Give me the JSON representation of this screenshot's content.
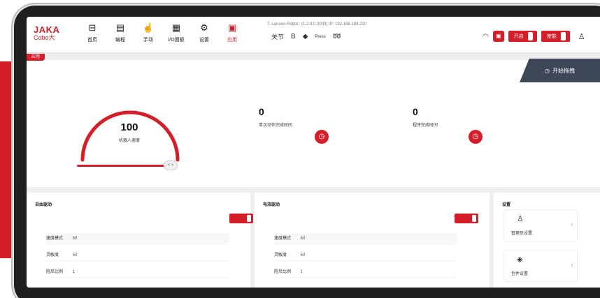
{
  "app": {
    "logo_main": "JAKA",
    "logo_sub": "Cobo大",
    "connection": "T: Lenovo-Robot.. (1.2.0.0.0000)    IP: 192.168.184.210"
  },
  "nav": [
    {
      "label": "首页",
      "icon": "monitor-icon",
      "active": false
    },
    {
      "label": "编程",
      "icon": "program-icon",
      "active": false
    },
    {
      "label": "手动",
      "icon": "hand-icon",
      "active": false
    },
    {
      "label": "I/O面板",
      "icon": "io-icon",
      "active": false
    },
    {
      "label": "设置",
      "icon": "gear-icon",
      "active": false
    },
    {
      "label": "应用",
      "icon": "app-icon",
      "active": true
    }
  ],
  "toolbar": {
    "mode_label": "关节",
    "items": [
      "B",
      "◆",
      "⊟",
      "➿"
    ],
    "small_label": "Press"
  },
  "right_buttons": {
    "power_label": "开启",
    "enable_label": "使能"
  },
  "panel_tag": "应用",
  "start_button": "开始拖拽",
  "gauge": {
    "value": "100",
    "label": "机器人速度",
    "fraction": 1.0,
    "slider_handle": "< >"
  },
  "stats": [
    {
      "value": "0",
      "label": "单次动作完成时间",
      "icon": "timer-icon"
    },
    {
      "value": "0",
      "label": "程序完成时间",
      "icon": "timer-icon"
    }
  ],
  "cards": [
    {
      "title": "自由驱动",
      "fields": [
        {
          "label": "速度模式",
          "value": "60"
        },
        {
          "label": "灵敏度",
          "value": "50"
        },
        {
          "label": "阻尼比例",
          "value": "1"
        }
      ]
    },
    {
      "title": "电流驱动",
      "fields": [
        {
          "label": "速度模式",
          "value": "60"
        },
        {
          "label": "灵敏度",
          "value": "50"
        },
        {
          "label": "阻尼比例",
          "value": "1"
        }
      ]
    }
  ],
  "settings": {
    "title": "设置",
    "items": [
      {
        "label": "管理员设置",
        "icon": "user-settings-icon"
      },
      {
        "label": "包件设置",
        "icon": "box-icon"
      }
    ]
  },
  "colors": {
    "accent": "#d41f2a",
    "dark_tab": "#3e4757",
    "bezel": "#1f1f1f"
  }
}
